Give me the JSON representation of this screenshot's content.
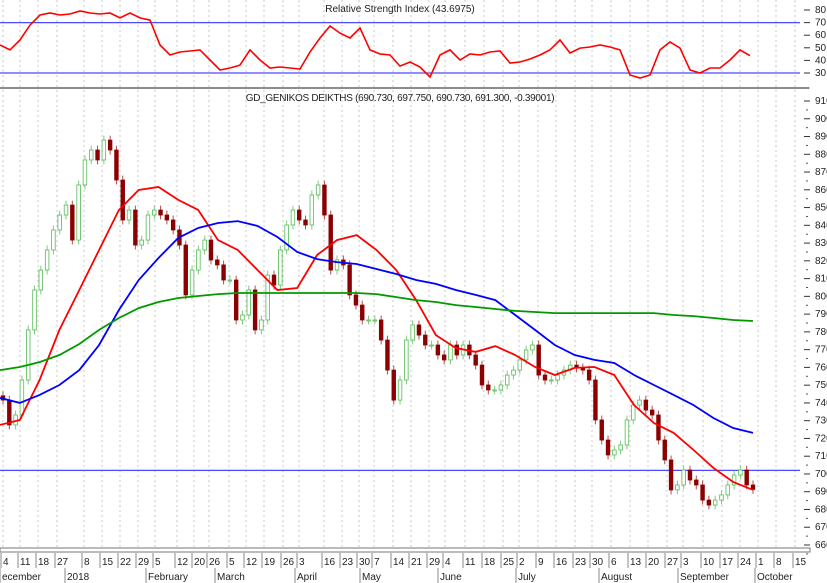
{
  "chart_data": {
    "type": "candlestick",
    "rsi_panel": {
      "title": "Relative Strength Index (43.6975)",
      "ylim": [
        25,
        85
      ],
      "ticks": [
        "80",
        "70",
        "60",
        "50",
        "40",
        "30"
      ],
      "tick_values": [
        80,
        70,
        60,
        50,
        40,
        30
      ],
      "overbought": 70,
      "oversold": 30,
      "values": [
        52.2,
        48.3,
        56.2,
        68,
        76,
        77.6,
        76,
        76.8,
        79.2,
        77.6,
        76.8,
        77.6,
        73.7,
        77.6,
        73.7,
        72,
        52.2,
        44.3,
        46.7,
        47.5,
        48.3,
        40.3,
        32.4,
        34,
        36.3,
        48.3,
        40.3,
        34,
        34.8,
        34,
        33.2,
        46.7,
        57.8,
        67.3,
        61.7,
        57.8,
        65.7,
        48.3,
        45.1,
        44.3,
        35.5,
        38.7,
        34.8,
        26.8,
        44.3,
        48.3,
        40.3,
        45.1,
        44.3,
        46.7,
        47.5,
        37.9,
        38.7,
        41.1,
        44.3,
        48.3,
        56.2,
        45.9,
        49.8,
        50.6,
        52.2,
        50.6,
        48.3,
        28.4,
        26,
        28.4,
        48.3,
        54.6,
        49.8,
        32.4,
        30,
        34,
        34,
        40.3,
        48.3,
        43.7
      ]
    },
    "price_panel": {
      "title": "GD_GENIKOS DEIKTHS (690.730, 697.750, 690.730, 691.300, -0.39001)",
      "ylim": [
        655,
        914
      ],
      "ticks": [
        "910",
        "900",
        "890",
        "880",
        "870",
        "860",
        "850",
        "840",
        "830",
        "820",
        "810",
        "800",
        "790",
        "780",
        "770",
        "760",
        "750",
        "740",
        "730",
        "720",
        "710",
        "700",
        "690",
        "680",
        "670",
        "660"
      ],
      "tick_values": [
        910,
        900,
        890,
        880,
        870,
        860,
        850,
        840,
        830,
        820,
        810,
        800,
        790,
        780,
        770,
        760,
        750,
        740,
        730,
        720,
        710,
        700,
        690,
        680,
        670,
        660
      ],
      "support_level": 702,
      "close": [
        741.6,
        727.6,
        733.2,
        752.9,
        781.1,
        803.6,
        814.8,
        826.1,
        837.4,
        845.8,
        851.4,
        831.7,
        862.7,
        876.8,
        882.4,
        876.8,
        888.0,
        882.4,
        865.5,
        843.0,
        848.6,
        828.9,
        831.7,
        845.8,
        848.6,
        845.8,
        843.0,
        837.4,
        828.9,
        800.8,
        814.8,
        826.1,
        831.7,
        820.5,
        817.7,
        809.2,
        809.2,
        786.7,
        789.5,
        803.6,
        781.1,
        786.7,
        812.0,
        806.4,
        826.1,
        840.2,
        848.6,
        843.0,
        840.2,
        857.1,
        862.7,
        845.8,
        814.8,
        820.5,
        817.7,
        800.8,
        795.1,
        786.7,
        786.7,
        786.7,
        775.4,
        758.5,
        741.6,
        752.9,
        775.4,
        783.9,
        778.2,
        772.6,
        772.6,
        767.0,
        764.2,
        772.6,
        767.0,
        772.6,
        767.0,
        761.3,
        750.1,
        747.3,
        747.3,
        750.1,
        755.7,
        758.5,
        764.2,
        769.8,
        772.6,
        755.7,
        752.9,
        752.9,
        755.7,
        758.5,
        761.3,
        759.7,
        758.5,
        752.9,
        730.4,
        719.1,
        710.7,
        713.5,
        716.3,
        730.4,
        738.8,
        741.6,
        736.0,
        733.2,
        719.1,
        707.9,
        691.0,
        693.8,
        702.2,
        696.6,
        693.8,
        685.3,
        682.5,
        685.3,
        688.2,
        693.8,
        699.4,
        702.2,
        693.8,
        691.3
      ],
      "first_open": 744,
      "series": [
        {
          "name": "MA short",
          "color": "#ff0000",
          "values": [
            727.6,
            730.4,
            752.9,
            781.1,
            803.6,
            826.1,
            848.6,
            859.9,
            861.6,
            854.3,
            848.6,
            831.7,
            826.1,
            814.8,
            803.6,
            804.7,
            823.3,
            831.7,
            834.5,
            826.1,
            814.8,
            797.9,
            778.2,
            770.9,
            768.7,
            772.0,
            767.0,
            760.2,
            755.7,
            759.7,
            760.2,
            755.7,
            738.8,
            728.7,
            723.1,
            713.5,
            703.4,
            695.5,
            691.0
          ]
        },
        {
          "name": "MA medium",
          "color": "#0000ff",
          "values": [
            742.8,
            740.0,
            744.5,
            750.1,
            758.5,
            772.6,
            792.3,
            809.2,
            821.6,
            832.9,
            838.5,
            841.3,
            842.4,
            839.6,
            833.4,
            825.0,
            821.0,
            819.3,
            818.2,
            815.4,
            812.6,
            809.2,
            807.0,
            803.6,
            800.8,
            797.9,
            789.5,
            781.1,
            772.6,
            767.0,
            764.2,
            762.5,
            755.7,
            750.1,
            744.5,
            738.8,
            731.5,
            725.9,
            723.1
          ]
        },
        {
          "name": "MA long",
          "color": "#009900",
          "values": [
            758.5,
            760.2,
            763.0,
            767.0,
            773.2,
            781.1,
            787.8,
            793.4,
            796.8,
            799.1,
            800.2,
            801.3,
            801.9,
            801.9,
            801.9,
            801.9,
            801.9,
            801.9,
            801.9,
            801.3,
            799.6,
            797.9,
            796.8,
            795.1,
            794.0,
            792.9,
            791.8,
            791.2,
            790.6,
            790.6,
            790.6,
            790.6,
            790.6,
            790.6,
            789.5,
            788.9,
            787.8,
            786.7,
            786.1
          ]
        }
      ]
    },
    "x_axis": {
      "day_ticks": [
        "4",
        "11",
        "18",
        "27",
        "8",
        "15",
        "22",
        "29",
        "5",
        "12",
        "20",
        "26",
        "5",
        "12",
        "19",
        "26",
        "3",
        "16",
        "23",
        "30",
        "7",
        "14",
        "21",
        "29",
        "4",
        "11",
        "18",
        "25",
        "2",
        "9",
        "16",
        "23",
        "30",
        "6",
        "13",
        "20",
        "27",
        "3",
        "10",
        "17",
        "24",
        "1",
        "8",
        "15"
      ],
      "months": [
        "ecember",
        "2018",
        "February",
        "March",
        "April",
        "May",
        "June",
        "July",
        "August",
        "September",
        "October"
      ]
    }
  },
  "colors": {
    "up": "#55bb55",
    "down": "#8b0000",
    "level": "#4a4aff",
    "grid": "#c8c8c8"
  }
}
